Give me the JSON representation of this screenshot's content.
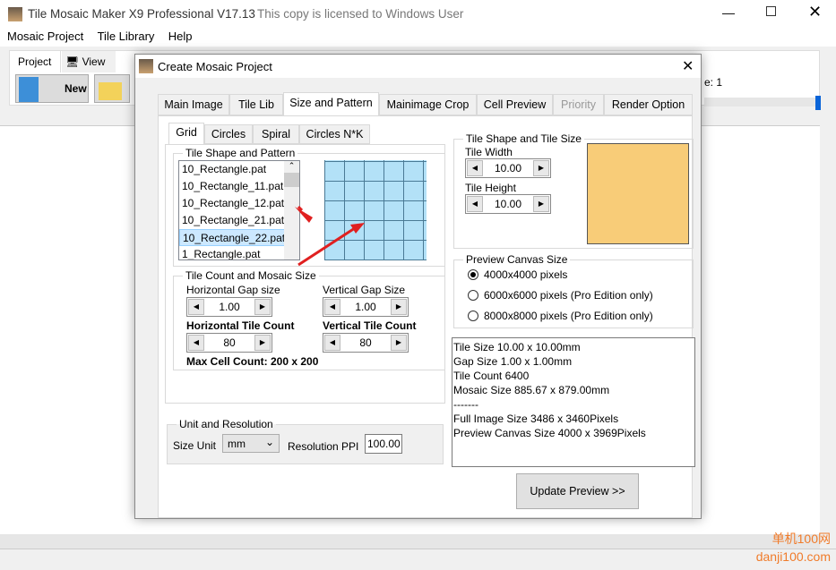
{
  "app": {
    "title": "Tile Mosaic Maker X9 Professional V17.13",
    "license": "This copy is licensed to Windows User"
  },
  "menu": [
    "Mosaic Project",
    "Tile Library",
    "Help"
  ],
  "ribbon": {
    "tabs": [
      "Project",
      "View"
    ],
    "new_label": "New",
    "right_text": "e: 1"
  },
  "dialog": {
    "title": "Create Mosaic Project",
    "tabs": [
      "Main Image",
      "Tile Lib",
      "Size and Pattern",
      "Mainimage Crop",
      "Cell Preview",
      "Priority",
      "Render Option"
    ],
    "subtabs": [
      "Grid",
      "Circles",
      "Spiral",
      "Circles N*K"
    ],
    "pattern": {
      "legend": "Tile Shape and Pattern",
      "items": [
        "10_Rectangle.pat",
        "10_Rectangle_11.pat",
        "10_Rectangle_12.pat",
        "10_Rectangle_21.pat",
        "10_Rectangle_22.pat",
        "1_Rectangle.pat"
      ],
      "selected": "10_Rectangle_22.pat"
    },
    "count": {
      "legend": "Tile Count and Mosaic Size",
      "hgap_label": "Horizontal Gap size",
      "hgap": "1.00",
      "vgap_label": "Vertical Gap Size",
      "vgap": "1.00",
      "hcount_label": "Horizontal Tile Count",
      "hcount": "80",
      "vcount_label": "Vertical Tile Count",
      "vcount": "80",
      "max": "Max Cell Count: 200 x 200"
    },
    "unit": {
      "legend": "Unit and Resolution",
      "size_unit_label": "Size Unit",
      "size_unit": "mm",
      "ppi_label": "Resolution PPI",
      "ppi": "100.00"
    },
    "shape": {
      "legend": "Tile Shape and Tile Size",
      "width_label": "Tile Width",
      "width": "10.00",
      "height_label": "Tile Height",
      "height": "10.00",
      "color": "#f8cc78"
    },
    "canvas": {
      "legend": "Preview Canvas Size",
      "options": [
        "4000x4000 pixels",
        "6000x6000 pixels (Pro Edition only)",
        "8000x8000 pixels (Pro Edition only)"
      ],
      "selected": 0
    },
    "info": [
      "Tile Size 10.00 x 10.00mm",
      "Gap Size 1.00 x 1.00mm",
      "Tile Count 6400",
      "Mosaic Size 885.67 x 879.00mm",
      "-------",
      "Full Image Size 3486 x 3460Pixels",
      "Preview Canvas Size 4000 x 3969Pixels"
    ],
    "update_label": "Update Preview >>"
  },
  "watermark": "单机100网 danji100.com",
  "icons": {
    "minimize": "minimize-icon",
    "maximize": "maximize-icon",
    "close": "close-icon"
  }
}
